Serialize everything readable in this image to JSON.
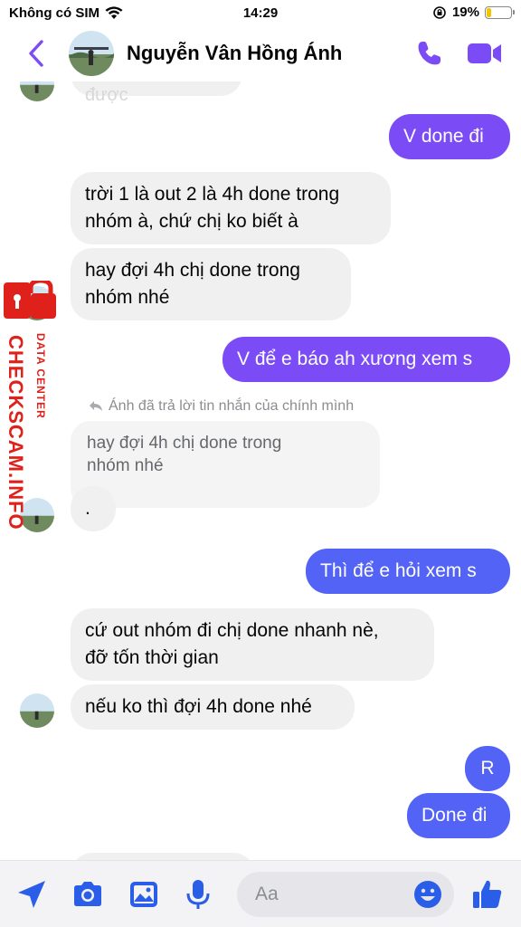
{
  "status_bar": {
    "carrier": "Không có SIM",
    "time": "14:29",
    "battery": "19%",
    "battery_level": 0.19
  },
  "header": {
    "contact_name": "Nguyễn Vân Hồng Ánh"
  },
  "messages": {
    "partial_top": "là không bảo được",
    "m1": "V done đi",
    "m2_line1": "trời 1 là out 2 là 4h done trong",
    "m2_line2": "nhóm à, chứ chị ko biết à",
    "m3_line1": "hay đợi 4h chị done trong",
    "m3_line2": "nhóm nhé",
    "m4": "V để e báo ah xương xem s",
    "reply_note": "Ánh đã trả lời tin nhắn của chính mình",
    "quoted_line1": "hay đợi 4h chị done trong",
    "quoted_line2": "nhóm nhé",
    "m5": ".",
    "m6": "Thì để e hỏi xem s",
    "m7_line1": "cứ out nhóm đi chị done nhanh nè,",
    "m7_line2": "đỡ tốn thời gian",
    "m8": "nếu ko thì đợi 4h done nhé",
    "m9": "R",
    "m10": "Done đi"
  },
  "watermark": {
    "site": "CHECKSCAM.INFO",
    "sub": "DATA CENTER"
  },
  "composer": {
    "placeholder": "Aa"
  },
  "colors": {
    "accent": "#7b4cf5",
    "sent_blue": "#5363f5",
    "incoming": "#f0f0f0",
    "watermark_red": "#e0201b"
  }
}
